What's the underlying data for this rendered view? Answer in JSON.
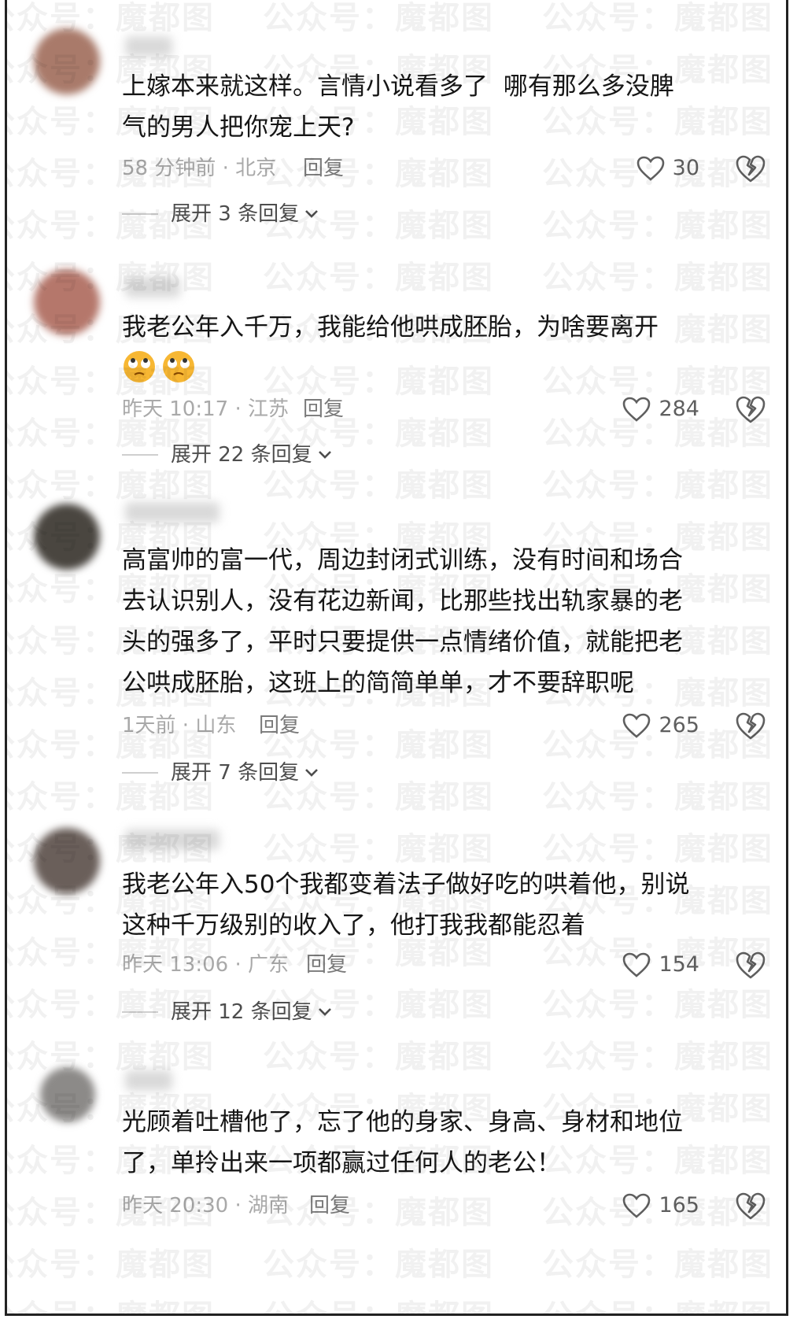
{
  "watermark": "公众号：魔都图",
  "comments": [
    {
      "avatar_color": "#a97a6a",
      "text": "上嫁本来就这样。言情小说看多了  哪有那么多没脾\n气的男人把你宠上天?",
      "meta": "58 分钟前 · 北京",
      "reply_label": "回复",
      "likes": "30",
      "expand": "展开 3 条回复"
    },
    {
      "avatar_color": "#b5776b",
      "text": "我老公年入千万，我能给他哄成胚胎，为啥要离开",
      "emoji": [
        "eye-roll-emoji",
        "eye-roll-emoji"
      ],
      "meta": "昨天 10:17 · 江苏",
      "reply_label": "回复",
      "likes": "284",
      "expand": "展开 22 条回复"
    },
    {
      "avatar_color": "#4a4640",
      "text": "高富帅的富一代，周边封闭式训练，没有时间和场合\n去认识别人，没有花边新闻，比那些找出轨家暴的老\n头的强多了，平时只要提供一点情绪价值，就能把老\n公哄成胚胎，这班上的简简单单，才不要辞职呢",
      "meta": "1天前 · 山东",
      "reply_label": "回复",
      "likes": "265",
      "expand": "展开 7 条回复"
    },
    {
      "avatar_color": "#6a5f5a",
      "text": "我老公年入50个我都变着法子做好吃的哄着他，别说\n这种千万级别的收入了，他打我我都能忍着",
      "meta": "昨天 13:06 · 广东",
      "reply_label": "回复",
      "likes": "154",
      "expand": "展开 12 条回复"
    },
    {
      "avatar_color": "#8c8a88",
      "text": "光顾着吐槽他了，忘了他的身家、身高、身材和地位\n了，单拎出来一项都赢过任何人的老公！",
      "meta": "昨天 20:30 · 湖南",
      "reply_label": "回复",
      "likes": "165"
    }
  ]
}
